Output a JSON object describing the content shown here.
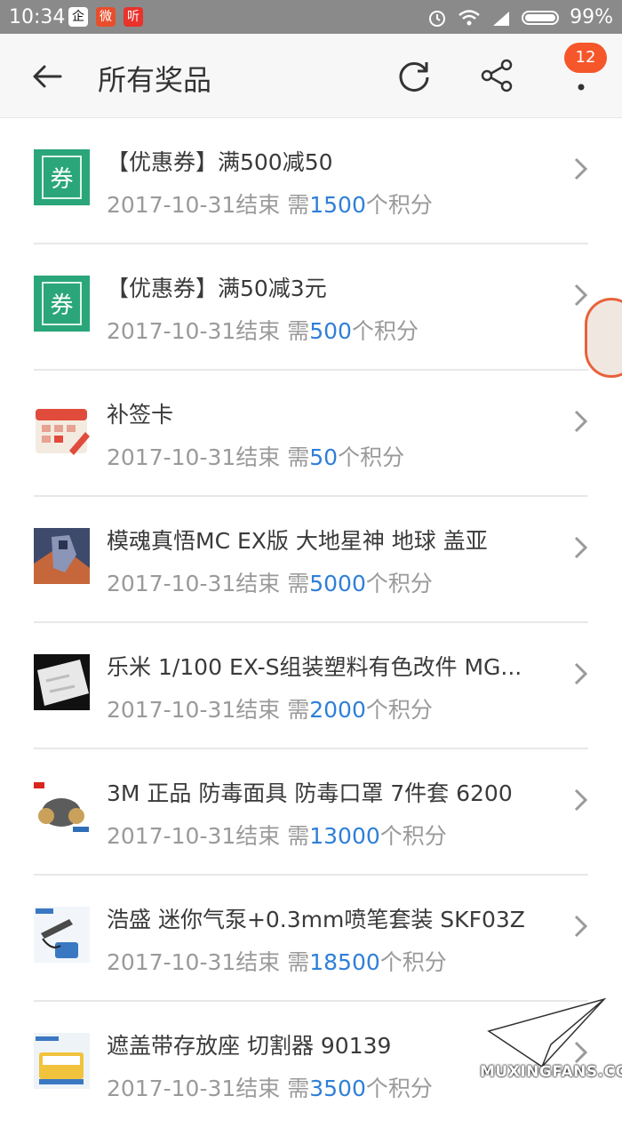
{
  "status_bar": {
    "time": "10:34",
    "apps": [
      {
        "icon": "qq-icon",
        "glyph": "企",
        "bg": "#ffffff",
        "fg": "#111111"
      },
      {
        "icon": "weibo-icon",
        "glyph": "微",
        "bg": "#e94e2b",
        "fg": "#ffffff"
      },
      {
        "icon": "listen-icon",
        "glyph": "听",
        "bg": "#e8322b",
        "fg": "#ffffff"
      }
    ],
    "battery": "99%"
  },
  "toolbar": {
    "title": "所有奖品",
    "badge": "12"
  },
  "colors": {
    "accent_blue": "#2f7fd8",
    "badge_orange": "#f5562a",
    "coupon_green": "#2aa67a"
  },
  "items": [
    {
      "name": "【优惠券】满500减50",
      "end": "2017-10-31结束 需",
      "points": "1500",
      "suffix": "个积分",
      "thumb": "coupon-icon"
    },
    {
      "name": "【优惠券】满50减3元",
      "end": "2017-10-31结束 需",
      "points": "500",
      "suffix": "个积分",
      "thumb": "coupon-icon"
    },
    {
      "name": "补签卡",
      "end": "2017-10-31结束 需",
      "points": "50",
      "suffix": "个积分",
      "thumb": "calendar-card-icon"
    },
    {
      "name": "模魂真悟MC EX版 大地星神 地球 盖亚",
      "end": "2017-10-31结束 需",
      "points": "5000",
      "suffix": "个积分",
      "thumb": "robot-figure-image"
    },
    {
      "name": "乐米 1/100 EX-S组装塑料有色改件 MG...",
      "end": "2017-10-31结束 需",
      "points": "2000",
      "suffix": "个积分",
      "thumb": "plastic-parts-image"
    },
    {
      "name": "3M 正品 防毒面具 防毒口罩 7件套 6200",
      "end": "2017-10-31结束 需",
      "points": "13000",
      "suffix": "个积分",
      "thumb": "gas-mask-image"
    },
    {
      "name": "浩盛 迷你气泵+0.3mm喷笔套装 SKF03Z",
      "end": "2017-10-31结束 需",
      "points": "18500",
      "suffix": "个积分",
      "thumb": "airbrush-kit-image"
    },
    {
      "name": "遮盖带存放座 切割器 90139",
      "end": "2017-10-31结束 需",
      "points": "3500",
      "suffix": "个积分",
      "thumb": "tape-cutter-image"
    }
  ],
  "watermark": "MUXINGFANS.COM"
}
